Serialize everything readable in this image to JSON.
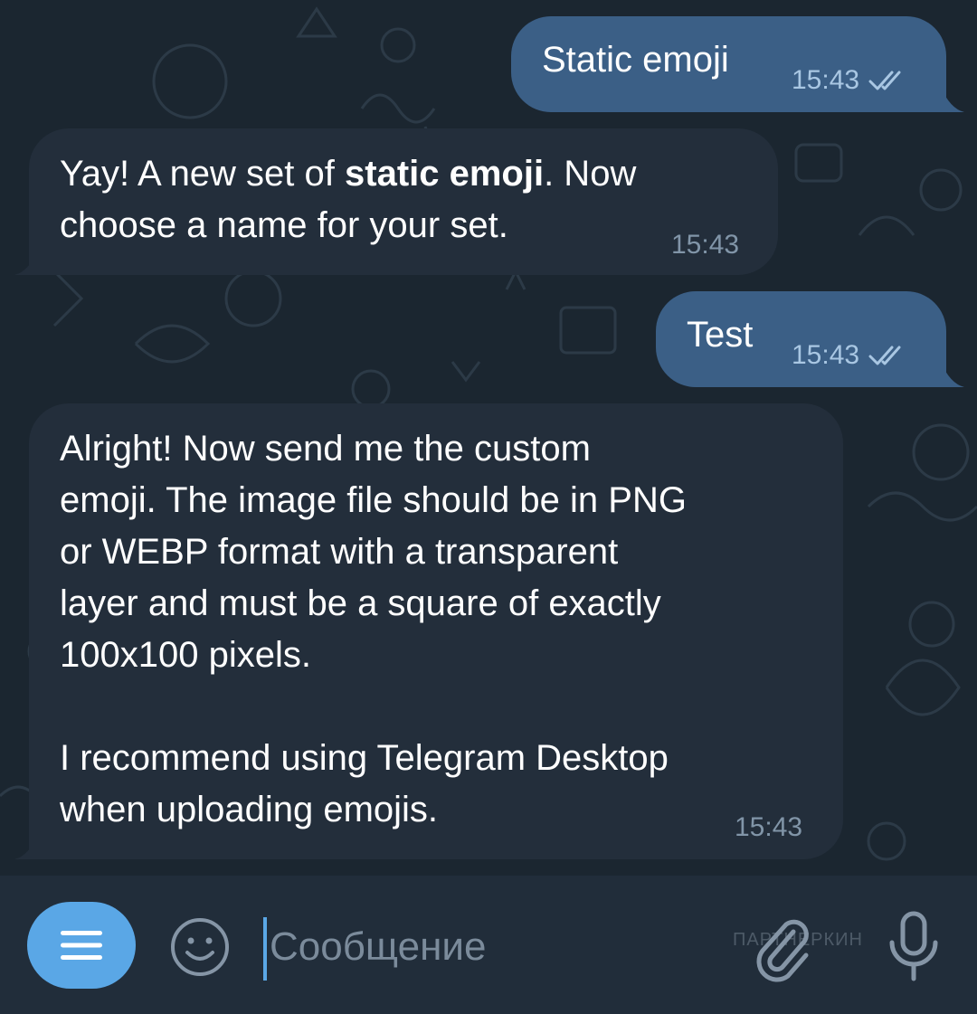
{
  "messages": [
    {
      "type": "outgoing",
      "text": "Static emoji",
      "time": "15:43",
      "status": "read-double-check"
    },
    {
      "type": "incoming",
      "text_pre": "Yay! A new set of ",
      "text_bold": "static emoji",
      "text_post": ". Now\nchoose a name for your set.",
      "time": "15:43"
    },
    {
      "type": "outgoing",
      "text": "Test",
      "time": "15:43",
      "status": "read-double-check"
    },
    {
      "type": "incoming",
      "text": "Alright! Now send me the custom\nemoji. The image file should be in PNG\nor WEBP format with a transparent\nlayer and must be a square of exactly\n100x100 pixels.\n\nI recommend using Telegram Desktop\nwhen uploading emojis.",
      "time": "15:43"
    }
  ],
  "input": {
    "placeholder": "Сообщение",
    "value": ""
  },
  "watermark": "ПАРТНЕРКИН",
  "icons": {
    "menu": "menu-icon",
    "emoji": "smiley-icon",
    "attach": "paperclip-icon",
    "mic": "microphone-icon",
    "read": "double-check-icon"
  },
  "colors": {
    "outgoing_bubble": "#3b5f86",
    "incoming_bubble": "#232e3b",
    "accent": "#5aa7e6",
    "background": "#18212b"
  }
}
